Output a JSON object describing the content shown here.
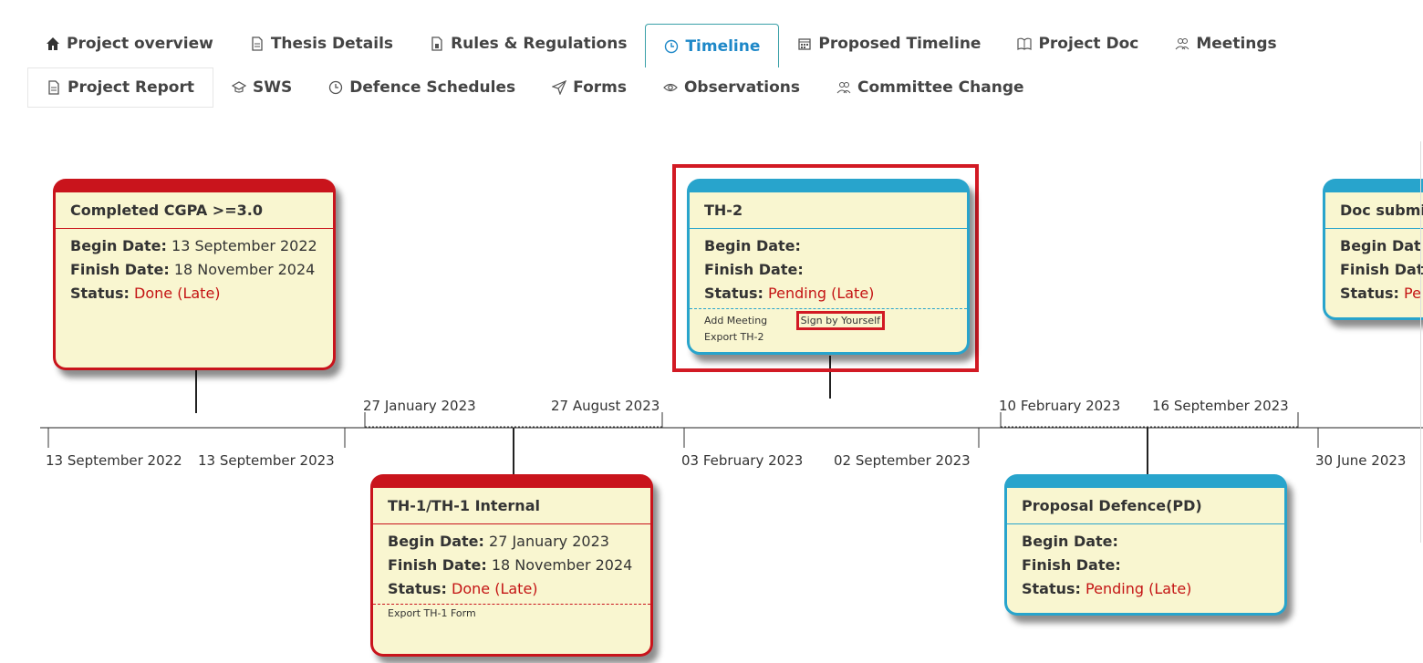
{
  "tabs_row1": [
    {
      "label": "Project overview",
      "icon": "home-icon"
    },
    {
      "label": "Thesis Details",
      "icon": "document-icon"
    },
    {
      "label": "Rules & Regulations",
      "icon": "document-icon"
    },
    {
      "label": "Timeline",
      "icon": "clock-icon",
      "active": true
    },
    {
      "label": "Proposed Timeline",
      "icon": "calendar-icon"
    },
    {
      "label": "Project Doc",
      "icon": "book-icon"
    },
    {
      "label": "Meetings",
      "icon": "users-icon"
    }
  ],
  "tabs_row2": [
    {
      "label": "Project Report",
      "icon": "document-icon"
    },
    {
      "label": "SWS",
      "icon": "graduation-cap-icon"
    },
    {
      "label": "Defence Schedules",
      "icon": "clock-icon"
    },
    {
      "label": "Forms",
      "icon": "send-icon"
    },
    {
      "label": "Observations",
      "icon": "eye-icon"
    },
    {
      "label": "Committee Change",
      "icon": "users-icon"
    }
  ],
  "labels": {
    "begin": "Begin Date:",
    "finish": "Finish Date:",
    "status": "Status:"
  },
  "cards": {
    "cgpa": {
      "title": "Completed CGPA >=3.0",
      "begin": "13 September 2022",
      "finish": "18 November 2024",
      "status": "Done (Late)"
    },
    "th1": {
      "title": "TH-1/TH-1 Internal",
      "begin": "27 January 2023",
      "finish": "18 November 2024",
      "status": "Done (Late)",
      "action_export": "Export TH-1 Form"
    },
    "th2": {
      "title": "TH-2",
      "begin": "",
      "finish": "",
      "status": "Pending (Late)",
      "action_meeting": "Add Meeting",
      "action_sign": "Sign by Yourself",
      "action_export": "Export TH-2"
    },
    "pd": {
      "title": "Proposal Defence(PD)",
      "begin": "",
      "finish": "",
      "status": "Pending (Late)"
    },
    "doc": {
      "title": "Doc submi",
      "begin_short": "Begin Dat",
      "finish_short": "Finish Dat",
      "status": "Pe"
    }
  },
  "timeline_dates": {
    "d1": "13 September 2022",
    "d2": "13 September 2023",
    "d3": "27 January 2023",
    "d4": "27 August 2023",
    "d5": "03 February 2023",
    "d6": "02 September 2023",
    "d7": "10 February 2023",
    "d8": "16 September 2023",
    "d9": "30 June 2023"
  },
  "colors": {
    "done_card": "#c9141c",
    "pending_card": "#28a4cc",
    "status_text": "#c41414",
    "active_tab": "#1e88c8",
    "highlight": "#d21a24"
  }
}
